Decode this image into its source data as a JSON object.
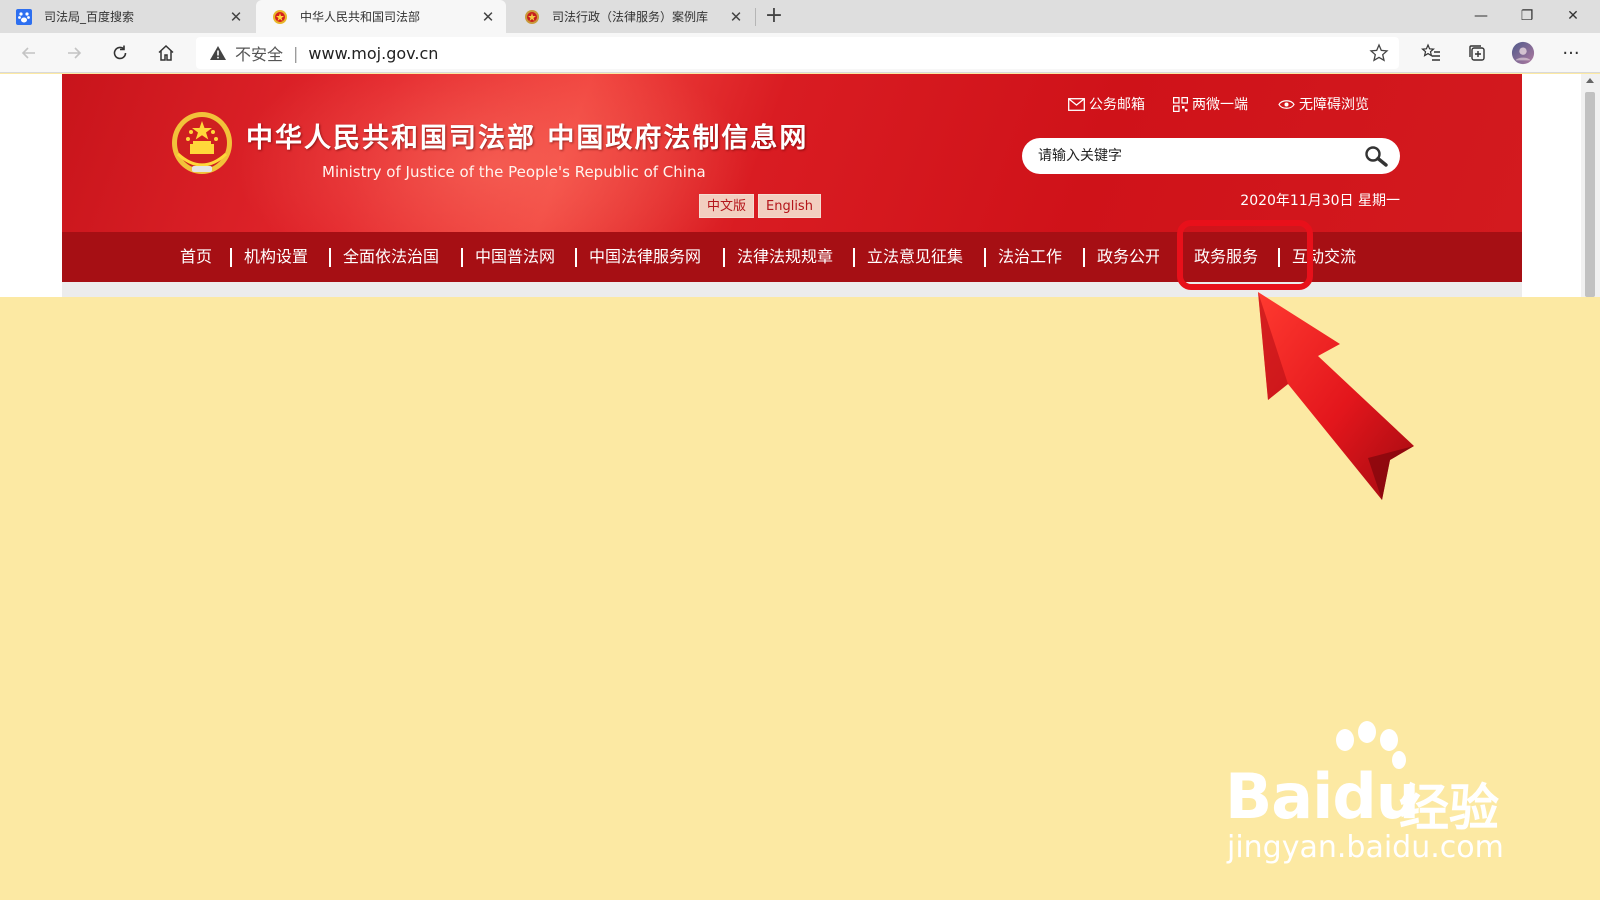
{
  "browser": {
    "tabs": [
      {
        "title": "司法局_百度搜索",
        "active": false
      },
      {
        "title": "中华人民共和国司法部",
        "active": true
      },
      {
        "title": "司法行政（法律服务）案例库",
        "active": false
      }
    ],
    "new_tab": "+",
    "window": {
      "minimize": "—",
      "maximize": "❐",
      "close": "✕"
    },
    "security_label": "不安全",
    "url": "www.moj.gov.cn"
  },
  "site": {
    "title": "中华人民共和国司法部  中国政府法制信息网",
    "subtitle": "Ministry of Justice of the People's Republic of China",
    "lang": {
      "cn": "中文版",
      "en": "English"
    },
    "toplinks": {
      "mail": "公务邮箱",
      "wechat": "两微一端",
      "accessible": "无障碍浏览"
    },
    "search_placeholder": "请输入关键字",
    "date": "2020年11月30日 星期一",
    "nav": [
      "首页",
      "机构设置",
      "全面依法治国",
      "中国普法网",
      "中国法律服务网",
      "法律法规规章",
      "立法意见征集",
      "法治工作",
      "政务公开",
      "政务服务",
      "互动交流"
    ]
  },
  "annotation": {
    "highlighted_nav": "政务服务"
  },
  "watermark": {
    "brand": "Bai",
    "brand_tail": "du",
    "brand_cn": "经验",
    "url": "jingyan.baidu.com"
  },
  "colors": {
    "brand_red": "#d31a1f",
    "nav_red": "#a60f14",
    "page_bg": "#fce9a3",
    "highlight": "#e8101a"
  }
}
